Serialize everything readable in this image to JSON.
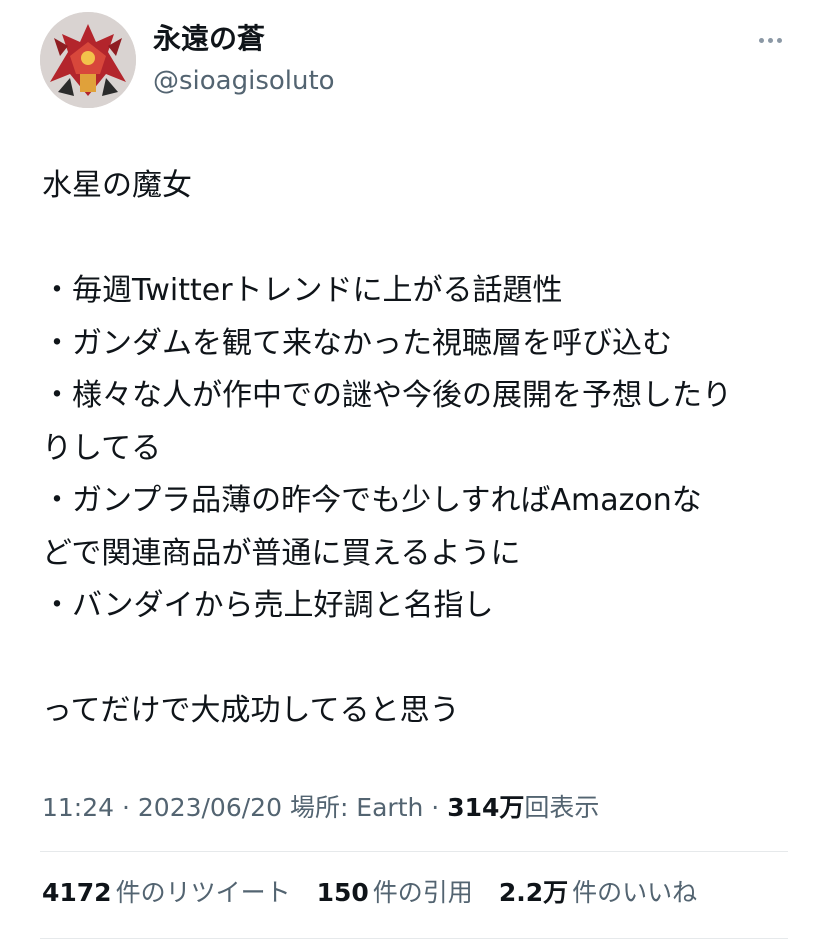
{
  "author": {
    "display_name": "永遠の蒼",
    "handle": "@sioagisoluto"
  },
  "tweet": {
    "lines": [
      "水星の魔女",
      "",
      "・毎週Twitterトレンドに上がる話題性",
      "・ガンダムを観て来なかった視聴層を呼び込む",
      "・様々な人が作中での謎や今後の展開を予想したり",
      "りしてる",
      "・ガンプラ品薄の昨今でも少しすればAmazonな",
      "どで関連商品が普通に買えるように",
      "・バンダイから売上好調と名指し",
      "",
      "ってだけで大成功してると思う"
    ]
  },
  "meta": {
    "time": "11:24",
    "separator": " · ",
    "date": "2023/06/20",
    "location": "場所: Earth",
    "views_count": "314万",
    "views_label": "回表示"
  },
  "stats": {
    "retweets_count": "4172",
    "retweets_label": "件のリツイート",
    "quotes_count": "150",
    "quotes_label": "件の引用",
    "likes_count": "2.2万",
    "likes_label": "件のいいね"
  },
  "icons": {
    "more": "more-horizontal-icon"
  }
}
